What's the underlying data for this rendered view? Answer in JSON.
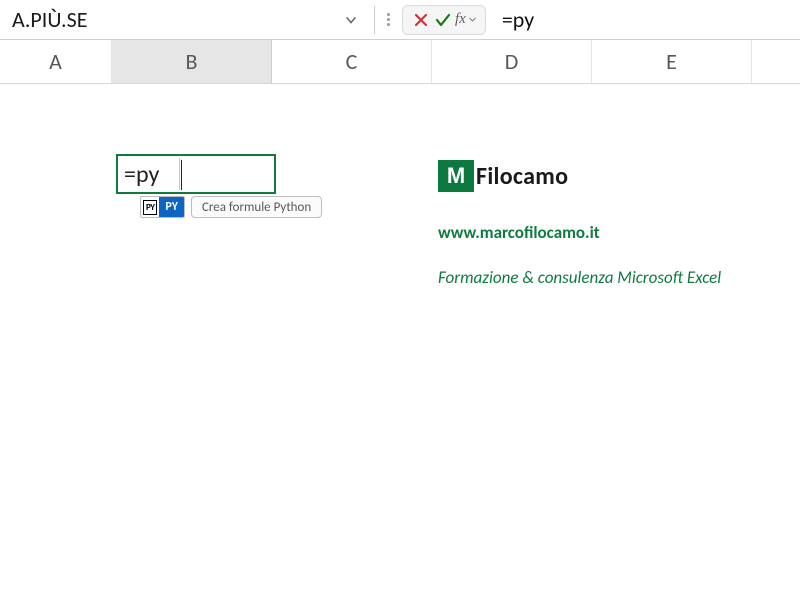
{
  "name_box": "A.PIÙ.SE",
  "formula_input": "=py",
  "columns": [
    "A",
    "B",
    "C",
    "D",
    "E"
  ],
  "active_column_index": 1,
  "editing_cell": {
    "value": "=py"
  },
  "autocomplete": {
    "icon_text": "PY",
    "label": "PY",
    "tooltip": "Crea formule Python"
  },
  "brand": {
    "mark": "M",
    "name": "Filocamo",
    "url": "www.marcofilocamo.it",
    "tagline": "Formazione & consulenza Microsoft Excel"
  },
  "fx_label": "fx"
}
